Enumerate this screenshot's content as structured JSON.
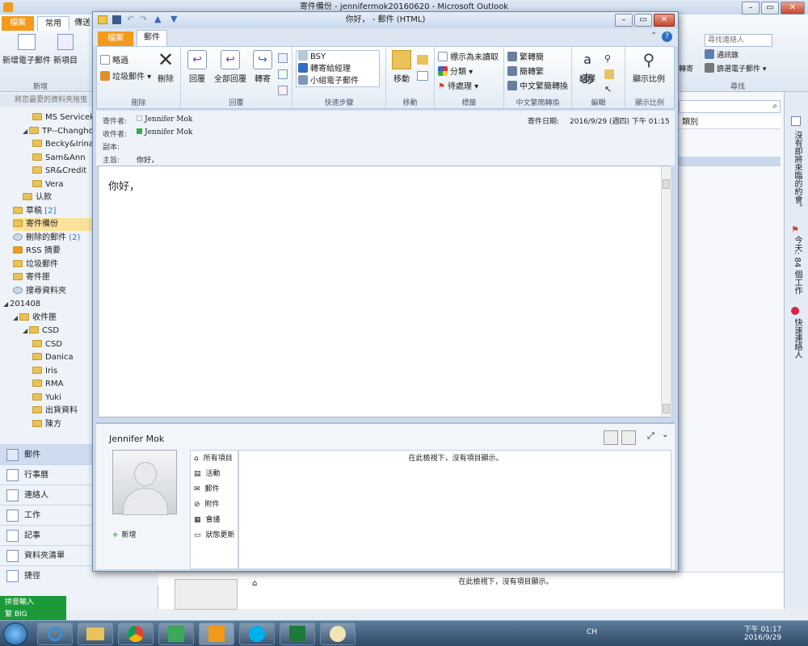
{
  "background": {
    "title": "寄件備份 - jennifermok20160620 - Microsoft Outlook",
    "tabs": {
      "file": "檔案",
      "home": "常用",
      "send": "傳送"
    },
    "new_mail": "新增電子郵件",
    "new_items": "新項目",
    "group_new": "新增",
    "favorites_hint": "將您最愛的資料夾拖曳",
    "search_contacts_placeholder": "尋找連絡人",
    "address_book": "通訊錄",
    "filter_mail": "篩選電子郵件",
    "group_find": "尋找",
    "reply_trunc": "轉寄",
    "category_col": "類別",
    "todo": {
      "appointments": "沒有即將來臨的約會。",
      "tasks": "今天: 84 個工作",
      "contacts": "快速連絡人"
    },
    "sidebar": {
      "folders": [
        {
          "label": "MS Servicekey",
          "indent": 2,
          "type": "folder"
        },
        {
          "label": "TP--Changho",
          "indent": 1,
          "type": "folder-open"
        },
        {
          "label": "Becky&Irina",
          "indent": 2,
          "type": "folder"
        },
        {
          "label": "Sam&Ann",
          "indent": 2,
          "type": "folder"
        },
        {
          "label": "SR&Credit",
          "indent": 2,
          "type": "folder"
        },
        {
          "label": "Vera",
          "indent": 2,
          "type": "folder"
        },
        {
          "label": "认款",
          "indent": 1,
          "type": "folder"
        },
        {
          "label": "草稿 [2]",
          "indent": 0,
          "type": "drafts"
        },
        {
          "label": "寄件備份",
          "indent": 0,
          "type": "sent",
          "selected": true
        },
        {
          "label": "刪除的郵件 (2)",
          "indent": 0,
          "type": "deleted"
        },
        {
          "label": "RSS 摘要",
          "indent": 0,
          "type": "rss"
        },
        {
          "label": "垃圾郵件",
          "indent": 0,
          "type": "junk"
        },
        {
          "label": "寄件匣",
          "indent": 0,
          "type": "outbox"
        },
        {
          "label": "搜尋資料夾",
          "indent": 0,
          "type": "search"
        },
        {
          "label": "201408",
          "indent": -1,
          "type": "root"
        },
        {
          "label": "收件匣",
          "indent": 0,
          "type": "folder-open"
        },
        {
          "label": "CSD",
          "indent": 1,
          "type": "folder-open"
        },
        {
          "label": "CSD",
          "indent": 2,
          "type": "folder"
        },
        {
          "label": "Danica",
          "indent": 2,
          "type": "folder"
        },
        {
          "label": "Iris",
          "indent": 2,
          "type": "folder"
        },
        {
          "label": "RMA",
          "indent": 2,
          "type": "folder"
        },
        {
          "label": "Yuki",
          "indent": 2,
          "type": "folder"
        },
        {
          "label": "出貨資料",
          "indent": 2,
          "type": "folder"
        },
        {
          "label": "陳方",
          "indent": 2,
          "type": "folder"
        }
      ],
      "nav": [
        "郵件",
        "行事曆",
        "連絡人",
        "工作",
        "記事",
        "資料夾清單",
        "捷徑"
      ]
    },
    "ime": {
      "line1": "拼音輸入",
      "line2": "繁 BIG"
    },
    "tray": {
      "lang": "CH",
      "time": "下午 01:17",
      "date": "2016/9/29"
    },
    "bottom_no_items": "在此檢視下，沒有項目顯示。"
  },
  "window": {
    "title": "你好， - 郵件 (HTML)",
    "tabs": {
      "file": "檔案",
      "message": "郵件"
    },
    "ribbon": {
      "ignore": "略過",
      "junk": "垃圾郵件",
      "delete": "刪除",
      "group_delete": "刪除",
      "reply": "回覆",
      "reply_all": "全部回覆",
      "forward": "轉寄",
      "group_respond": "回覆",
      "quick_steps": [
        "BSY",
        "轉寄給經理",
        "小組電子郵件"
      ],
      "group_quick": "快速步驟",
      "move": "移動",
      "group_move": "移動",
      "mark_unread": "標示為未讀取",
      "categorize": "分類",
      "follow_up": "待處理",
      "group_tags": "標籤",
      "to_trad": "繁轉簡",
      "to_simp": "簡轉繁",
      "zh_convert": "中文繁簡轉換",
      "group_zh": "中文繁簡轉換",
      "translate": "翻譯",
      "group_edit": "編輯",
      "zoom": "顯示比例",
      "group_zoom": "顯示比例"
    },
    "header": {
      "from_label": "寄件者:",
      "from": "Jennifer Mok",
      "to_label": "收件者:",
      "to": "Jennifer Mok",
      "cc_label": "副本:",
      "subject_label": "主旨:",
      "subject": "你好，",
      "sent_label": "寄件日期:",
      "sent": "2016/9/29 (週四) 下午 01:15"
    },
    "body": "你好，",
    "people": {
      "name": "Jennifer Mok",
      "items": [
        "所有項目",
        "活動",
        "郵件",
        "附件",
        "會議",
        "狀態更新"
      ],
      "no_items": "在此檢視下，沒有項目顯示。",
      "add": "新增"
    }
  },
  "colors": {
    "accent_file_tab": "#f39a1a",
    "selected_folder": "#fbe19a",
    "ime_bar": "#1c9a3a"
  }
}
